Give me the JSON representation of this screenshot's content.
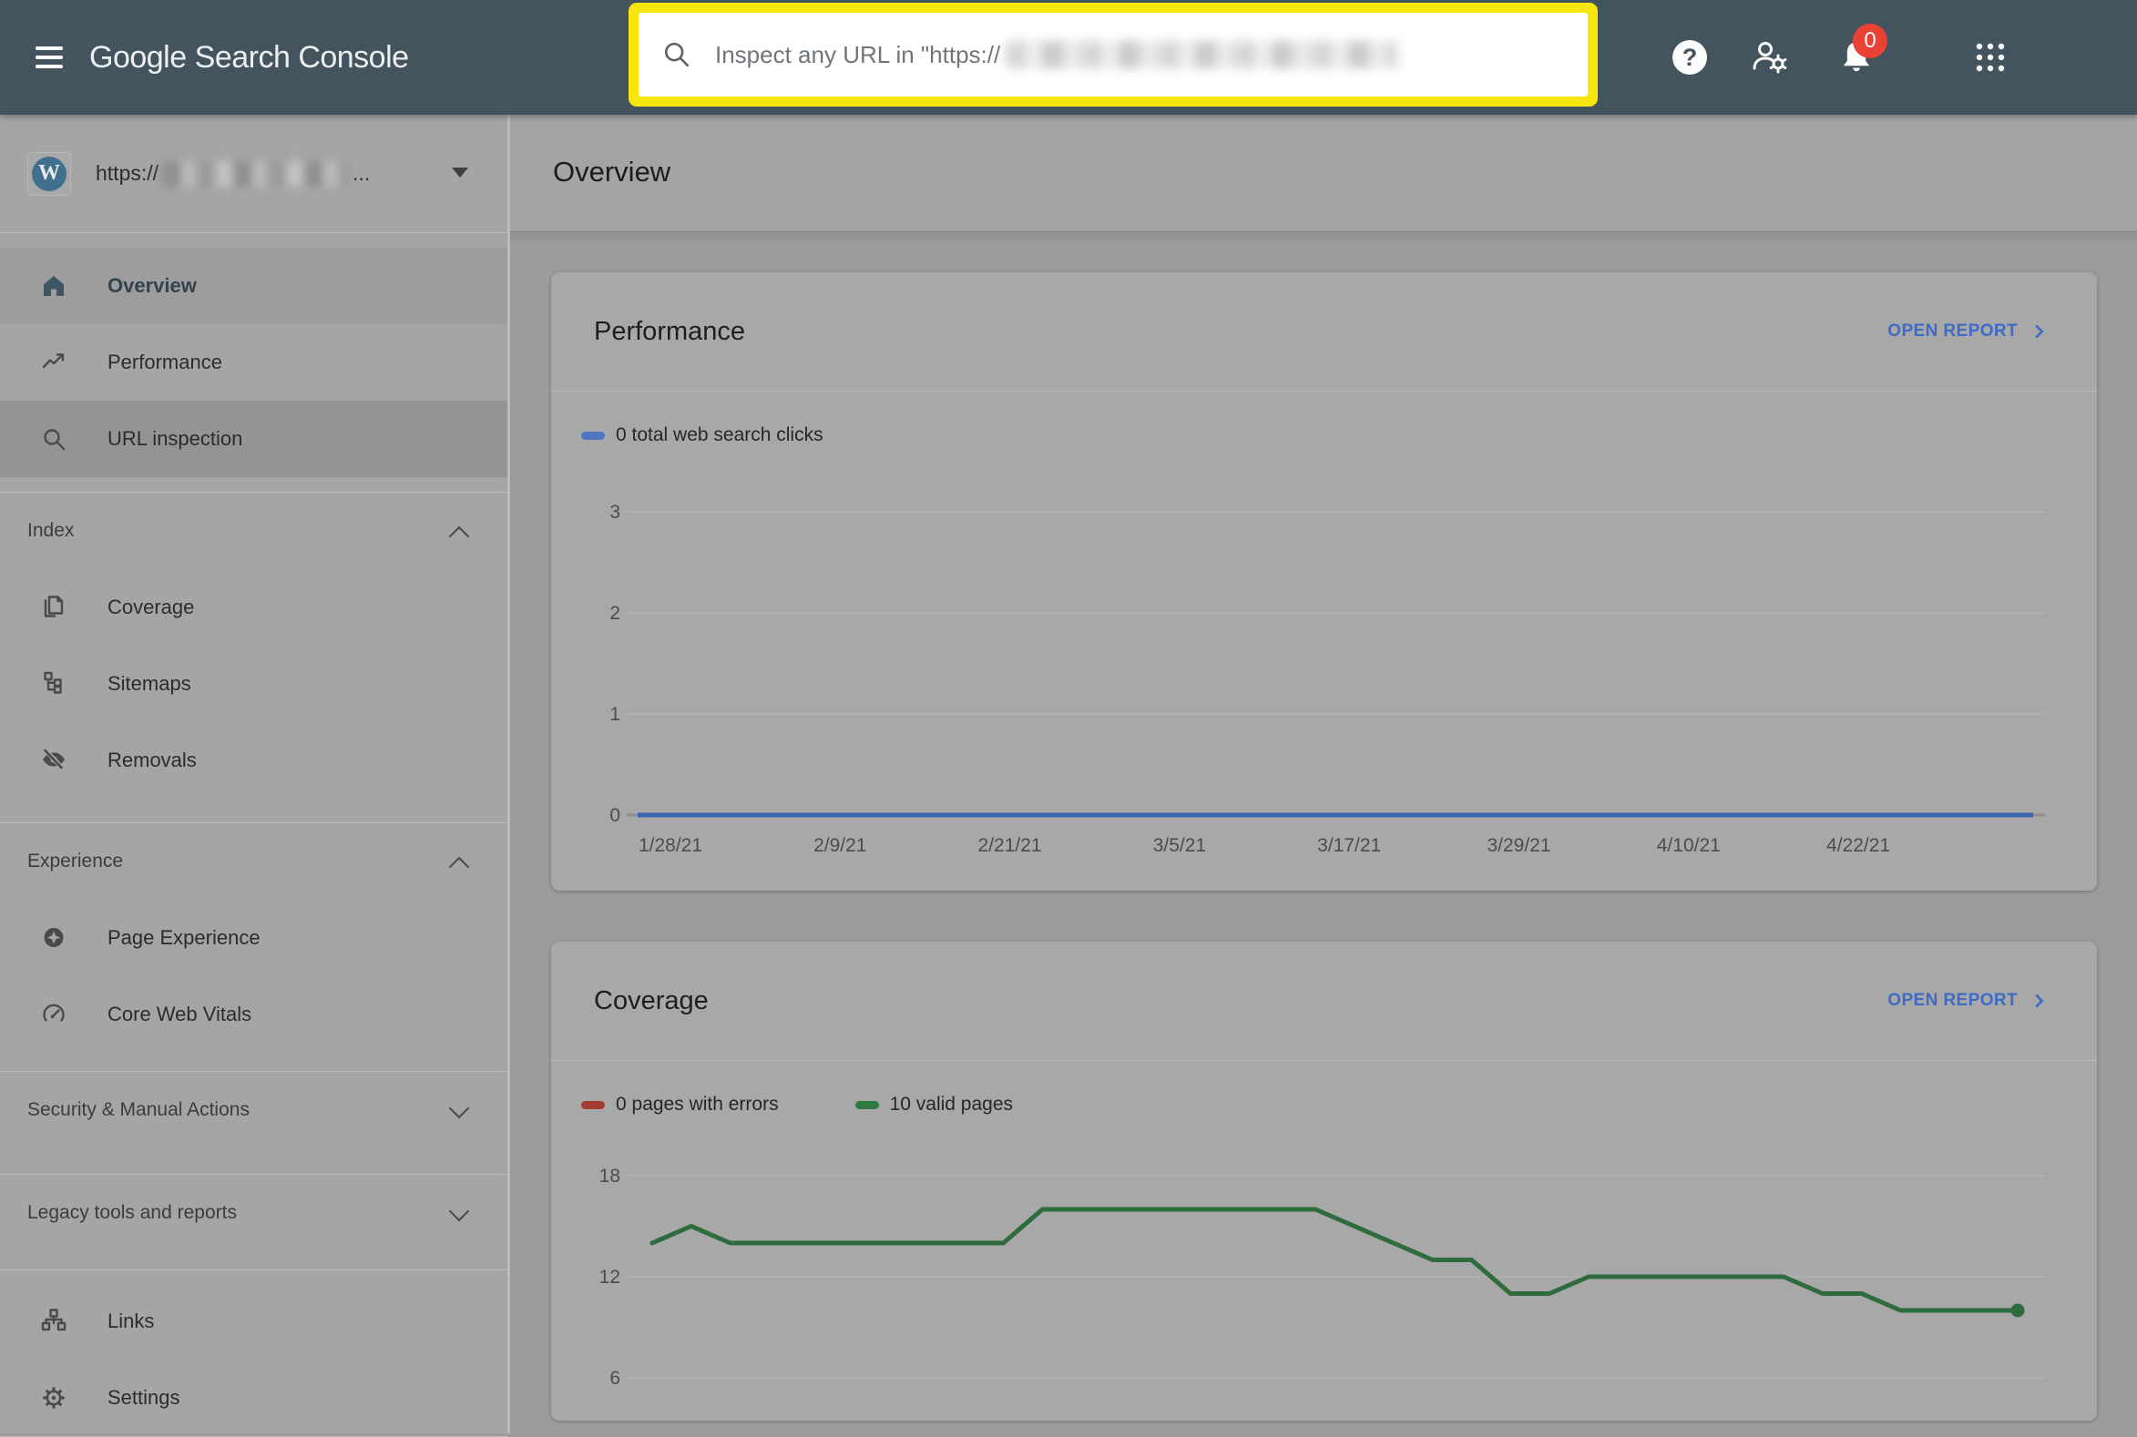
{
  "colors": {
    "topbar_bg": "#43545e",
    "highlight_yellow": "#f7e60d",
    "badge_red": "#e94235",
    "link_blue": "#3e6bc6",
    "legend_blue": "#4e74c4",
    "line_blue": "#3c63b0",
    "legend_red": "#a43c31",
    "legend_green": "#2e7a42",
    "line_green": "#2e6b3d"
  },
  "topbar": {
    "logo_google": "Google",
    "logo_product": "Search Console",
    "search_placeholder": "Inspect any URL in \"https://",
    "notification_badge": "0"
  },
  "sidebar": {
    "property": {
      "url_prefix": "https://",
      "url_suffix": "...",
      "icon": "wordpress",
      "wp_monogram": "W"
    },
    "sections": [
      {
        "items": [
          {
            "label": "Overview",
            "icon": "home",
            "state": "selected"
          },
          {
            "label": "Performance",
            "icon": "performance",
            "state": "normal"
          },
          {
            "label": "URL inspection",
            "icon": "url-inspection",
            "state": "highlighted"
          }
        ]
      },
      {
        "header": "Index",
        "expanded": true,
        "items": [
          {
            "label": "Coverage",
            "icon": "coverage",
            "state": "normal"
          },
          {
            "label": "Sitemaps",
            "icon": "sitemaps",
            "state": "normal"
          },
          {
            "label": "Removals",
            "icon": "removals",
            "state": "normal"
          }
        ]
      },
      {
        "header": "Experience",
        "expanded": true,
        "items": [
          {
            "label": "Page Experience",
            "icon": "page-experience",
            "state": "normal"
          },
          {
            "label": "Core Web Vitals",
            "icon": "core-web-vitals",
            "state": "normal"
          }
        ]
      },
      {
        "header": "Security & Manual Actions",
        "expanded": false,
        "items": []
      },
      {
        "header": "Legacy tools and reports",
        "expanded": false,
        "items": []
      },
      {
        "items": [
          {
            "label": "Links",
            "icon": "links",
            "state": "normal"
          },
          {
            "label": "Settings",
            "icon": "settings",
            "state": "normal"
          }
        ]
      }
    ]
  },
  "main": {
    "page_title": "Overview",
    "cards": [
      {
        "title": "Performance",
        "action": "OPEN REPORT",
        "legend": [
          {
            "label": "0 total web search clicks",
            "color_key": "legend_blue"
          }
        ]
      },
      {
        "title": "Coverage",
        "action": "OPEN REPORT",
        "legend": [
          {
            "label": "0 pages with errors",
            "color_key": "legend_red"
          },
          {
            "label": "10 valid pages",
            "color_key": "legend_green"
          }
        ]
      }
    ]
  },
  "chart_data": [
    {
      "type": "line",
      "title": "Performance: total web search clicks",
      "categories": [
        "1/28/21",
        "2/9/21",
        "2/21/21",
        "3/5/21",
        "3/17/21",
        "3/29/21",
        "4/10/21",
        "4/22/21"
      ],
      "series": [
        {
          "name": "0 total web search clicks",
          "color_key": "line_blue",
          "values": [
            0,
            0,
            0,
            0,
            0,
            0,
            0,
            0
          ]
        }
      ],
      "ylim": [
        0,
        3
      ],
      "yticks": [
        3,
        2,
        1,
        0
      ],
      "grid": true,
      "legend_position": "top-left"
    },
    {
      "type": "line",
      "title": "Coverage: indexed pages over time",
      "series": [
        {
          "name": "0 pages with errors",
          "color_key": "legend_red",
          "values": [
            0,
            0,
            0,
            0,
            0,
            0,
            0,
            0,
            0,
            0,
            0,
            0,
            0,
            0,
            0,
            0,
            0,
            0,
            0,
            0,
            0,
            0,
            0,
            0,
            0,
            0,
            0,
            0,
            0,
            0,
            0,
            0,
            0,
            0,
            0,
            0
          ]
        },
        {
          "name": "10 valid pages",
          "color_key": "line_green",
          "end_marker": "dot",
          "values": [
            14,
            15,
            14,
            14,
            14,
            14,
            14,
            14,
            14,
            14,
            16,
            16,
            16,
            16,
            16,
            16,
            16,
            16,
            15,
            14,
            13,
            13,
            11,
            11,
            12,
            12,
            12,
            12,
            12,
            12,
            11,
            11,
            10,
            10,
            10,
            10
          ]
        }
      ],
      "ylim": [
        0,
        18
      ],
      "yticks": [
        18,
        12,
        6
      ],
      "grid": true,
      "legend_position": "top-left"
    }
  ]
}
